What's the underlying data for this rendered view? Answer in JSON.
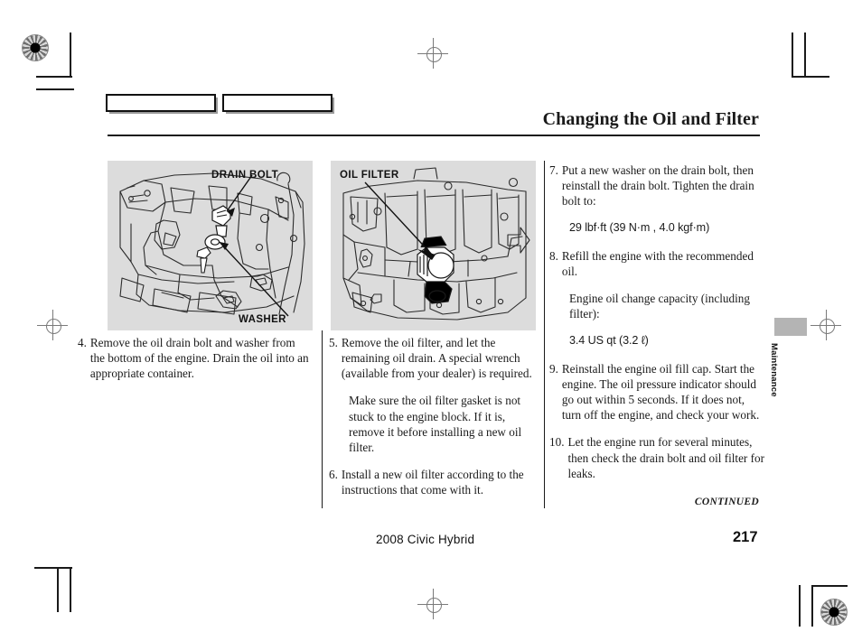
{
  "document": {
    "title": "Changing the Oil and Filter",
    "continued_label": "CONTINUED",
    "side_tab_label": "Maintenance"
  },
  "footer": {
    "model": "2008  Civic  Hybrid",
    "page_number": "217"
  },
  "figures": {
    "left": {
      "name": "underbody-drain-bolt-illustration",
      "labels": {
        "drain_bolt": "DRAIN BOLT",
        "washer": "WASHER"
      }
    },
    "right": {
      "name": "engine-oil-filter-illustration",
      "labels": {
        "oil_filter": "OIL FILTER"
      }
    }
  },
  "columns": {
    "left": {
      "steps": [
        {
          "number": "4.",
          "text": "Remove the oil drain bolt and washer from the bottom of the engine. Drain the oil into an appropriate container."
        }
      ]
    },
    "middle": {
      "steps": [
        {
          "number": "5.",
          "text": "Remove the oil filter, and let the remaining oil drain. A special wrench (available from your dealer) is required."
        },
        {
          "number": "6.",
          "text": "Install a new oil filter according to the instructions that come with it."
        }
      ],
      "note": "Make sure the oil filter gasket is not stuck to the engine block. If it is, remove it before installing a new oil filter."
    },
    "right": {
      "steps": [
        {
          "number": "7.",
          "text": "Put a new washer on the drain bolt, then reinstall the drain bolt. Tighten the drain bolt to:"
        },
        {
          "number": "8.",
          "text": "Refill the engine with the recommended oil."
        },
        {
          "number": "9.",
          "text": "Reinstall the engine oil fill cap. Start the engine. The oil pressure indicator should go out within 5 seconds. If it does not, turn off the engine, and check your work."
        },
        {
          "number": "10.",
          "text": "Let the engine run for several minutes, then check the drain bolt and oil filter for leaks."
        }
      ],
      "torque_spec": "29 lbf·ft (39 N·m , 4.0 kgf·m)",
      "capacity_heading": "Engine oil change capacity (including filter):",
      "capacity_spec": "3.4 US qt (3.2 ℓ)"
    }
  }
}
